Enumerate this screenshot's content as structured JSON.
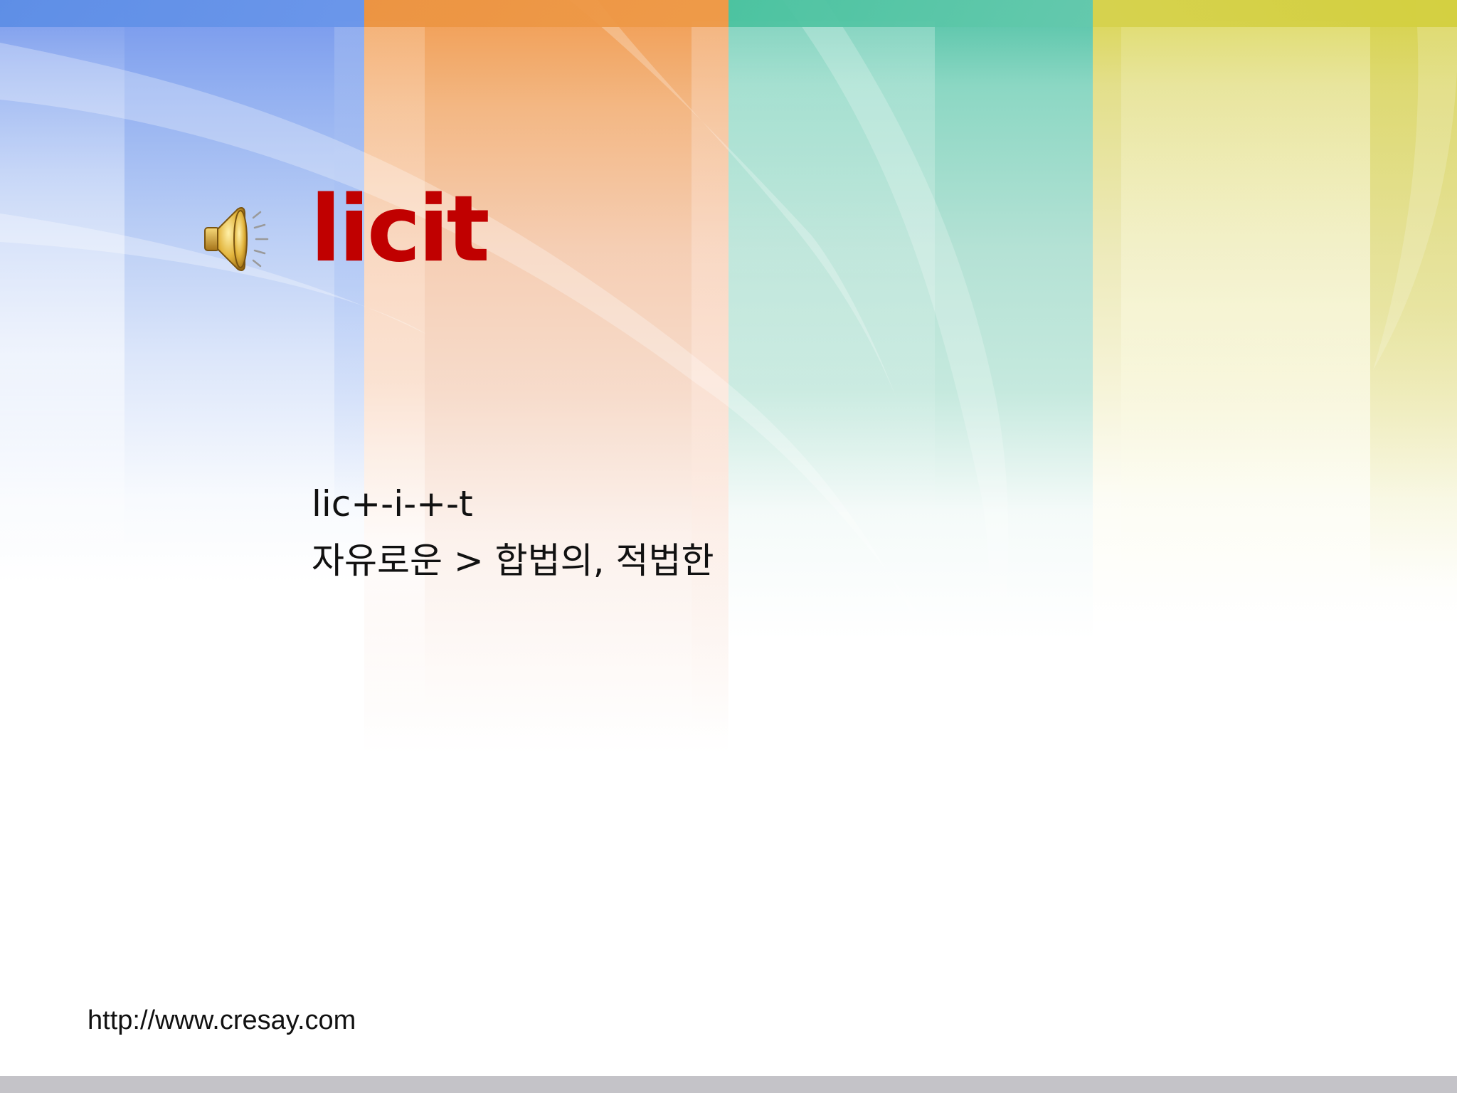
{
  "slide": {
    "title": "licit",
    "pronunciation": "lic+-i-+-t",
    "meaning": "자유로운 > 합법의, 적법한",
    "footer_url": "http://www.cresay.com",
    "speaker_icon": "speaker-icon"
  },
  "colors": {
    "title": "#c00000",
    "band_blue": "#6a96ea",
    "band_orange": "#ee9a48",
    "band_green": "#4cc3a0",
    "band_yellow": "#d6d24e",
    "bottom_bar": "#c4c3c8"
  }
}
